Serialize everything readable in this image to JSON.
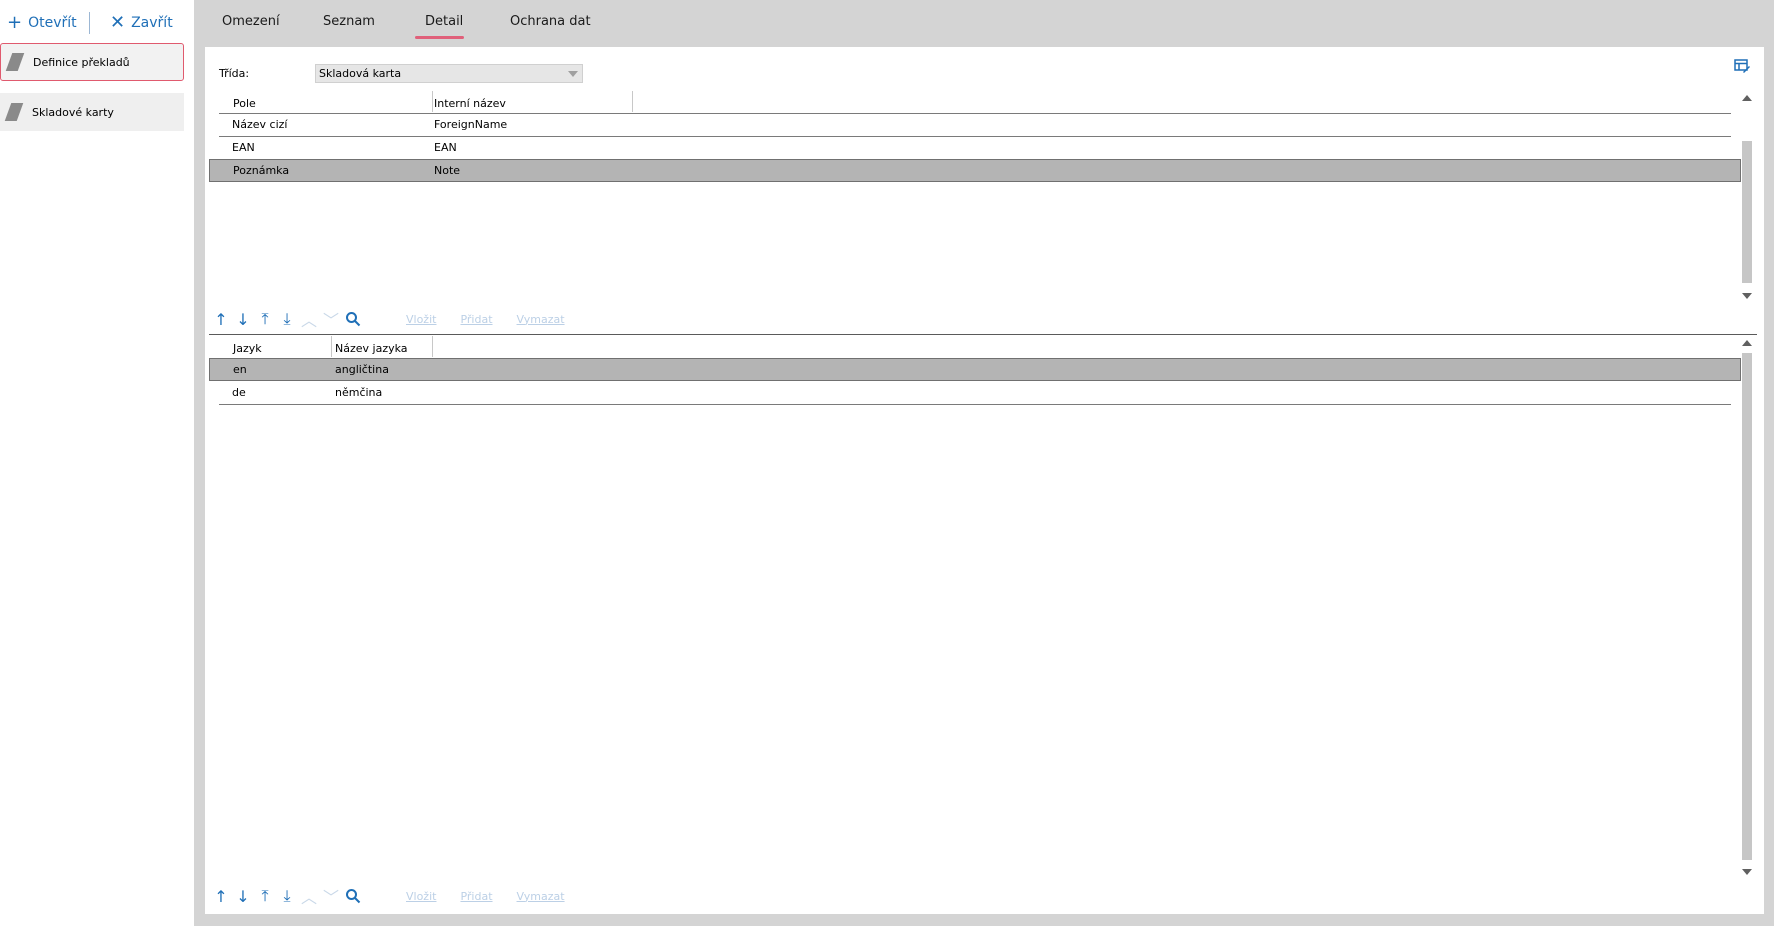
{
  "sidebar": {
    "open_label": "Otevřít",
    "close_label": "Zavřít",
    "items": [
      {
        "label": "Definice překladů"
      },
      {
        "label": "Skladové karty"
      }
    ]
  },
  "tabs": [
    {
      "label": "Omezení"
    },
    {
      "label": "Seznam"
    },
    {
      "label": "Detail"
    },
    {
      "label": "Ochrana dat"
    }
  ],
  "active_tab": "Detail",
  "form": {
    "class_label": "Třída:",
    "class_value": "Skladová karta"
  },
  "fields_grid": {
    "columns": [
      "Pole",
      "Interní název"
    ],
    "rows": [
      [
        "Název cizí",
        "ForeignName"
      ],
      [
        "EAN",
        "EAN"
      ],
      [
        "Poznámka",
        "Note"
      ]
    ],
    "selected_row": 2
  },
  "languages_grid": {
    "columns": [
      "Jazyk",
      "Název jazyka"
    ],
    "rows": [
      [
        "en",
        "angličtina"
      ],
      [
        "de",
        "němčina"
      ]
    ],
    "selected_row": 0
  },
  "toolbar": {
    "insert_label": "Vložit",
    "add_label": "Přidat",
    "delete_label": "Vymazat"
  },
  "icons": [
    "plus-icon",
    "close-icon",
    "arrow-up-icon",
    "arrow-down-icon",
    "arrow-first-icon",
    "arrow-last-icon",
    "chevron-up-icon",
    "chevron-down-icon",
    "search-icon",
    "layout-edit-icon"
  ],
  "colors": {
    "accent": "#1f6fb7",
    "tab_underline": "#e0607a",
    "selected_row": "#b4b4b4",
    "frame": "#d4d4d4"
  }
}
